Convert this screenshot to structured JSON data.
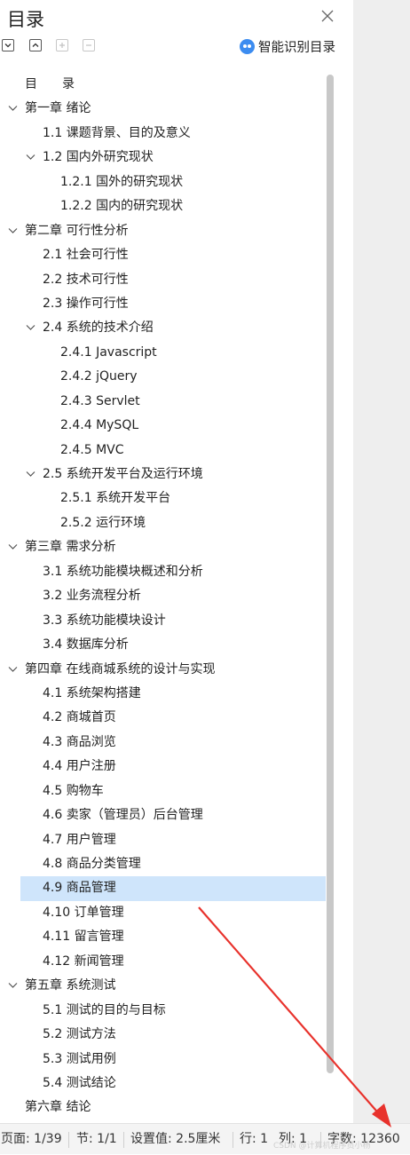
{
  "title": "目录",
  "toolbar": {
    "expand_icon": "chevron-down-box-icon",
    "collapse_icon": "chevron-up-box-icon",
    "add_icon": "plus-box-icon",
    "remove_icon": "minus-box-icon"
  },
  "smart_toc_label": "智能识别目录",
  "toc_items": [
    {
      "text": "目　　录",
      "level": 0,
      "arrow": false
    },
    {
      "text": "第一章  绪论",
      "level": 0,
      "arrow": true
    },
    {
      "text": "1.1  课题背景、目的及意义",
      "level": 1,
      "arrow": false
    },
    {
      "text": "1.2  国内外研究现状",
      "level": 1,
      "arrow": true
    },
    {
      "text": "1.2.1  国外的研究现状",
      "level": 2,
      "arrow": false
    },
    {
      "text": "1.2.2  国内的研究现状",
      "level": 2,
      "arrow": false
    },
    {
      "text": "第二章  可行性分析",
      "level": 0,
      "arrow": true
    },
    {
      "text": "2.1  社会可行性",
      "level": 1,
      "arrow": false
    },
    {
      "text": "2.2  技术可行性",
      "level": 1,
      "arrow": false
    },
    {
      "text": "2.3  操作可行性",
      "level": 1,
      "arrow": false
    },
    {
      "text": "2.4  系统的技术介绍",
      "level": 1,
      "arrow": true
    },
    {
      "text": "2.4.1 Javascript",
      "level": 2,
      "arrow": false
    },
    {
      "text": "2.4.2 jQuery",
      "level": 2,
      "arrow": false
    },
    {
      "text": "2.4.3 Servlet",
      "level": 2,
      "arrow": false
    },
    {
      "text": "2.4.4 MySQL",
      "level": 2,
      "arrow": false
    },
    {
      "text": "2.4.5 MVC",
      "level": 2,
      "arrow": false
    },
    {
      "text": "2.5  系统开发平台及运行环境",
      "level": 1,
      "arrow": true
    },
    {
      "text": "2.5.1  系统开发平台",
      "level": 2,
      "arrow": false
    },
    {
      "text": "2.5.2  运行环境",
      "level": 2,
      "arrow": false
    },
    {
      "text": "第三章  需求分析",
      "level": 0,
      "arrow": true
    },
    {
      "text": "3.1  系统功能模块概述和分析",
      "level": 1,
      "arrow": false
    },
    {
      "text": "3.2  业务流程分析",
      "level": 1,
      "arrow": false
    },
    {
      "text": "3.3  系统功能模块设计",
      "level": 1,
      "arrow": false
    },
    {
      "text": "3.4  数据库分析",
      "level": 1,
      "arrow": false
    },
    {
      "text": "第四章  在线商城系统的设计与实现",
      "level": 0,
      "arrow": true
    },
    {
      "text": "4.1    系统架构搭建",
      "level": 1,
      "arrow": false
    },
    {
      "text": "4.2    商城首页",
      "level": 1,
      "arrow": false
    },
    {
      "text": "4.3    商品浏览",
      "level": 1,
      "arrow": false
    },
    {
      "text": "4.4    用户注册",
      "level": 1,
      "arrow": false
    },
    {
      "text": "4.5    购物车",
      "level": 1,
      "arrow": false
    },
    {
      "text": "4.6    卖家（管理员）后台管理",
      "level": 1,
      "arrow": false
    },
    {
      "text": "4.7    用户管理",
      "level": 1,
      "arrow": false
    },
    {
      "text": "4.8    商品分类管理",
      "level": 1,
      "arrow": false
    },
    {
      "text": "4.9    商品管理",
      "level": 1,
      "arrow": false,
      "selected": true
    },
    {
      "text": "4.10    订单管理",
      "level": 1,
      "arrow": false
    },
    {
      "text": "4.11    留言管理",
      "level": 1,
      "arrow": false
    },
    {
      "text": "4.12    新闻管理",
      "level": 1,
      "arrow": false
    },
    {
      "text": "第五章  系统测试",
      "level": 0,
      "arrow": true
    },
    {
      "text": "5.1  测试的目的与目标",
      "level": 1,
      "arrow": false
    },
    {
      "text": "5.2  测试方法",
      "level": 1,
      "arrow": false
    },
    {
      "text": "5.3  测试用例",
      "level": 1,
      "arrow": false
    },
    {
      "text": "5.4  测试结论",
      "level": 1,
      "arrow": false
    },
    {
      "text": "第六章  结论",
      "level": 0,
      "arrow": false
    }
  ],
  "status": {
    "page": "页面: 1/39",
    "section": "节: 1/1",
    "setting": "设置值: 2.5厘米",
    "row": "行: 1",
    "col": "列: 1",
    "wordcount": "字数: 12360"
  },
  "watermark": "CSDN @计算机程序员小杨",
  "colors": {
    "selected_bg": "#cfe5fb",
    "smart_icon": "#3c8cf0",
    "annotation_arrow": "#e8322c"
  }
}
